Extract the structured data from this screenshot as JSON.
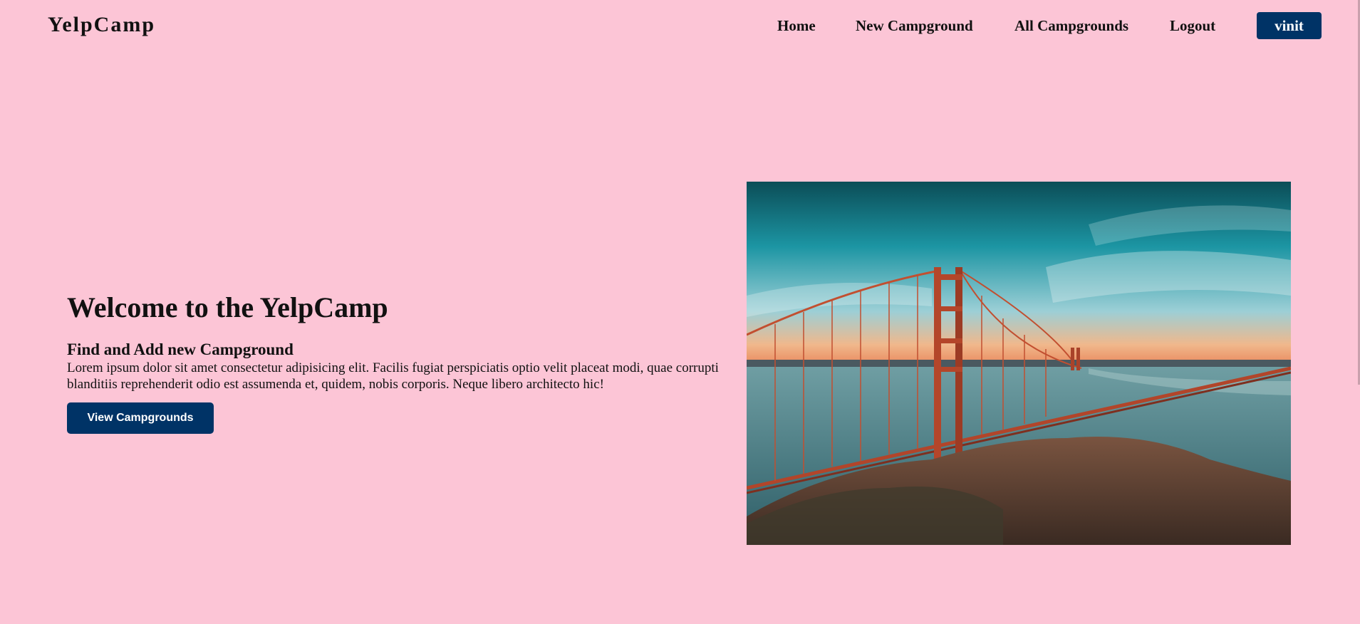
{
  "navbar": {
    "brand": "YelpCamp",
    "links": [
      "Home",
      "New Campground",
      "All Campgrounds",
      "Logout"
    ],
    "user_label": "vinit"
  },
  "hero": {
    "title": "Welcome to the YelpCamp",
    "subtitle": "Find and Add new Campground",
    "text": "Lorem ipsum dolor sit amet consectetur adipisicing elit. Facilis fugiat perspiciatis optio velit placeat modi, quae corrupti blanditiis reprehenderit odio est assumenda et, quidem, nobis corporis. Neque libero architecto hic!",
    "button_label": "View Campgrounds",
    "image_subject": "golden-gate-bridge-photo"
  },
  "colors": {
    "background": "#fcc5d6",
    "button": "#003366",
    "text": "#111111"
  }
}
